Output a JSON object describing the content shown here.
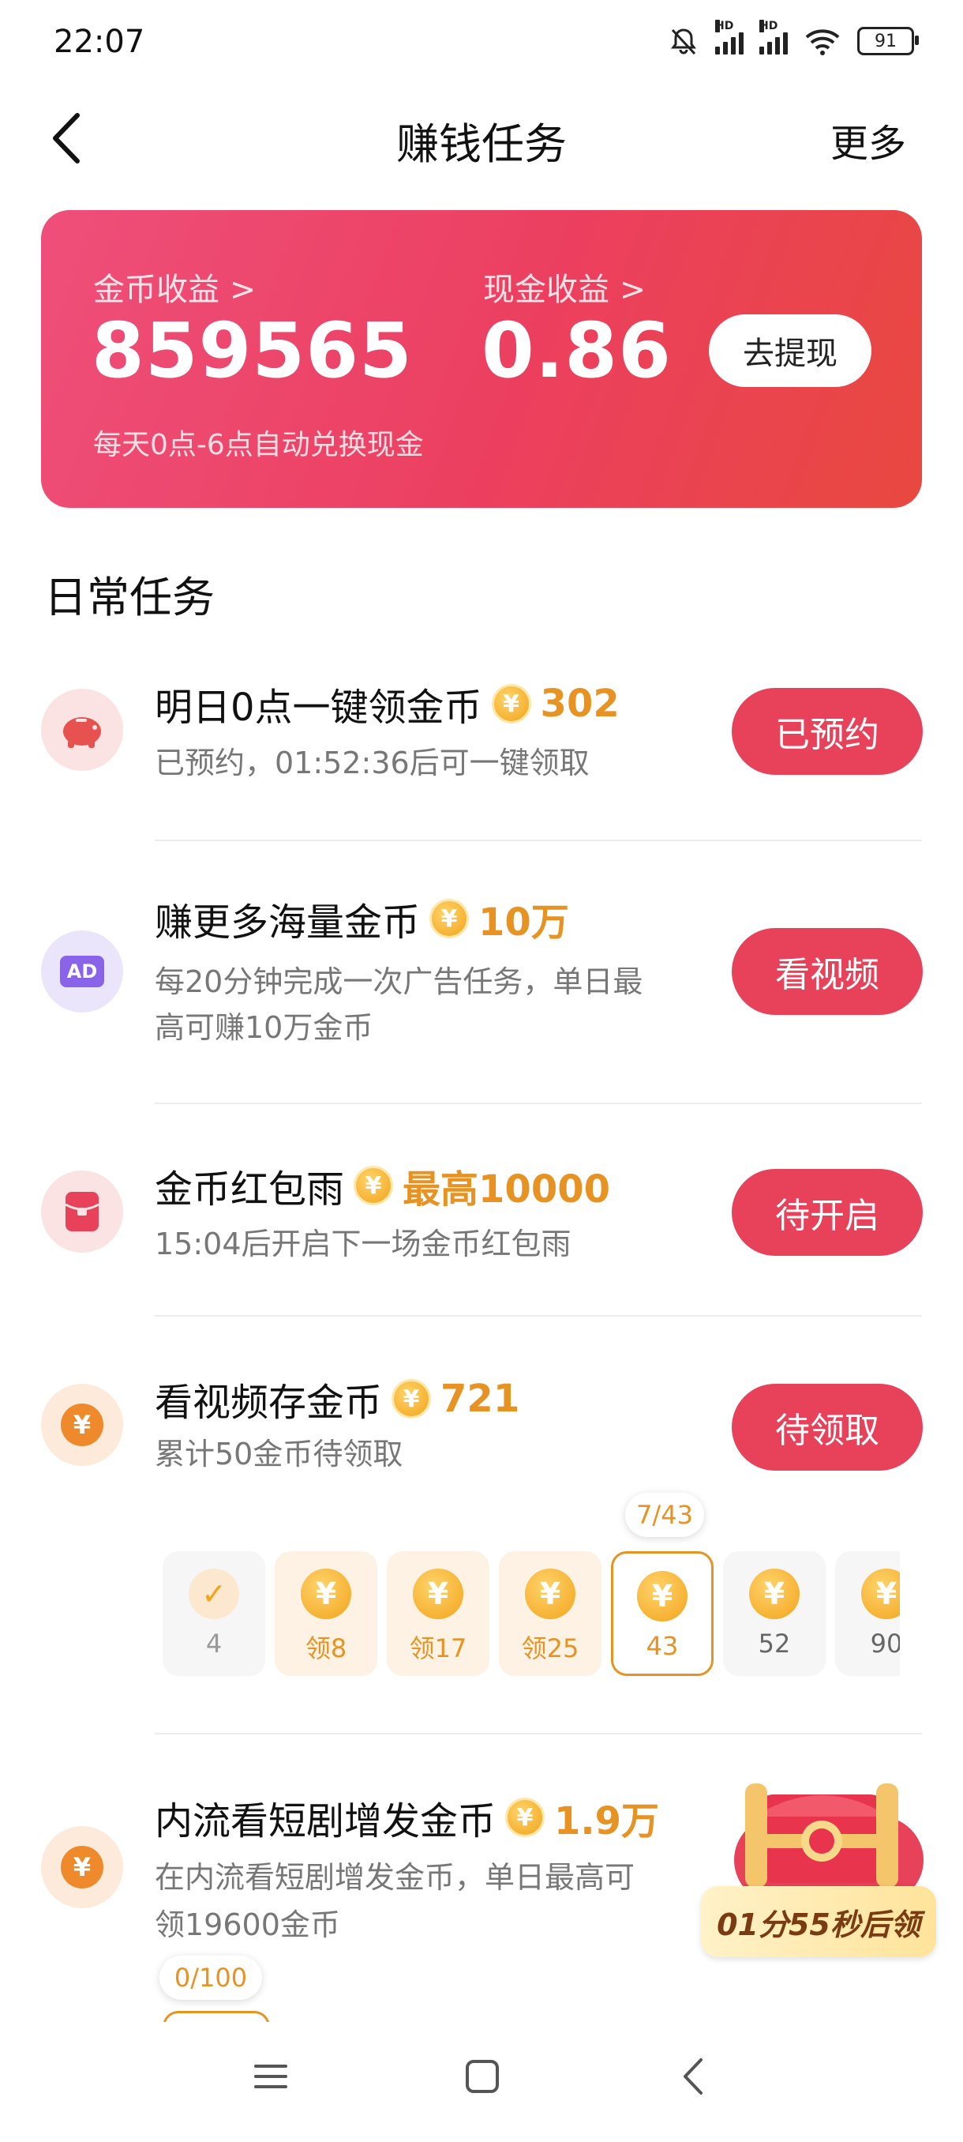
{
  "status_bar": {
    "time": "22:07",
    "battery": "91",
    "hd": "HD"
  },
  "header": {
    "title": "赚钱任务",
    "more": "更多"
  },
  "earnings": {
    "coin_label": "金币收益 >",
    "coin_value": "859565",
    "cash_label": "现金收益 >",
    "cash_value": "0.86",
    "withdraw": "去提现",
    "note": "每天0点-6点自动兑换现金"
  },
  "section_title": "日常任务",
  "tasks": [
    {
      "title": "明日0点一键领金币",
      "reward": "302",
      "desc": "已预约，01:52:36后可一键领取",
      "button": "已预约",
      "icon": "piggy-bank-icon"
    },
    {
      "title": "赚更多海量金币",
      "reward": "10万",
      "desc1": "每20分钟完成一次广告任务，单日最",
      "desc2": "高可赚10万金币",
      "button": "看视频",
      "icon": "ad-icon",
      "icon_text": "AD"
    },
    {
      "title": "金币红包雨",
      "reward": "最高10000",
      "desc": "15:04后开启下一场金币红包雨",
      "button": "待开启",
      "icon": "red-envelope-icon"
    },
    {
      "title": "看视频存金币",
      "reward": "721",
      "desc": "累计50金币待领取",
      "button": "待领取",
      "icon": "coin-icon"
    },
    {
      "title": "内流看短剧增发金币",
      "reward": "1.9万",
      "desc1": "在内流看短剧增发金币，单日最高可",
      "desc2": "领19600金币",
      "icon": "coin-icon"
    }
  ],
  "steps": {
    "progress": "7/43",
    "items": [
      "4",
      "领8",
      "领17",
      "领25",
      "43",
      "52",
      "90"
    ]
  },
  "drama_progress": "0/100",
  "promo": {
    "label": "01分55秒后领"
  },
  "coin_symbol": "¥",
  "colors": {
    "accent": "#e8415a",
    "gold": "#e79324",
    "card_start": "#ee4f7a",
    "card_end": "#e8483f"
  },
  "nav": [
    "menu-icon",
    "home-icon",
    "back-icon"
  ]
}
